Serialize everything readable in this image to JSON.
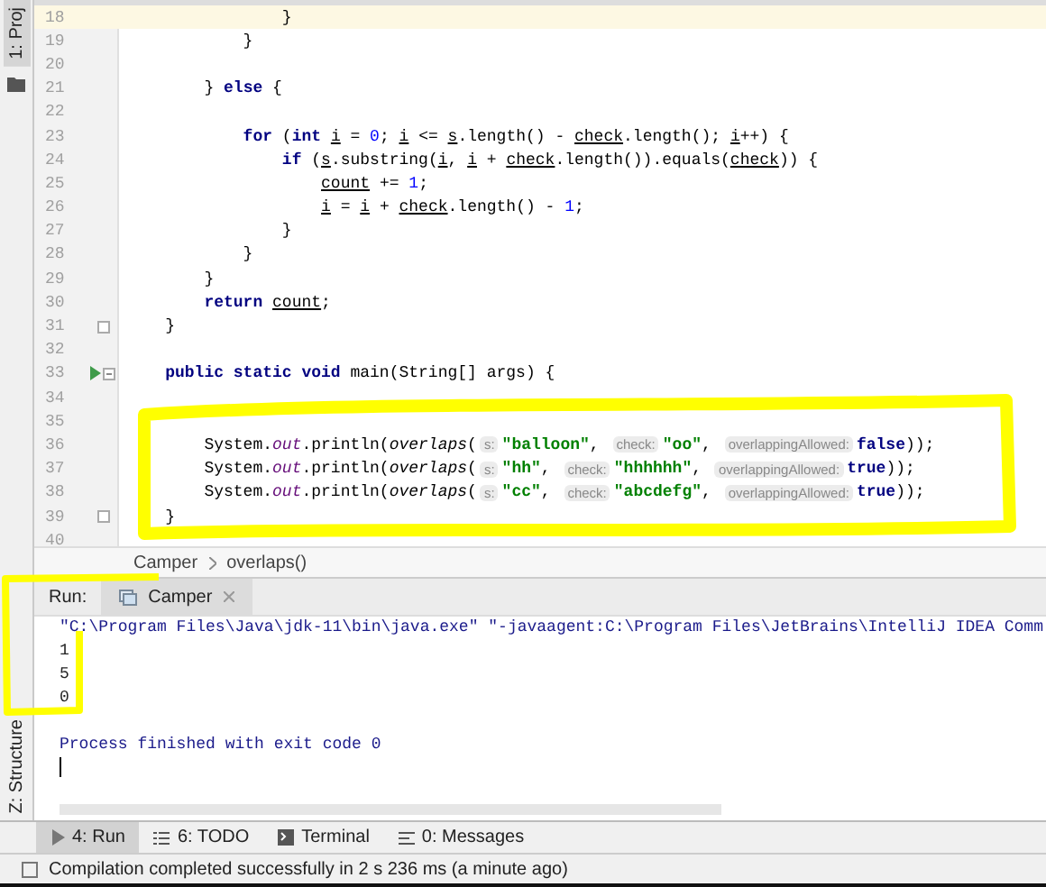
{
  "left_strip": {
    "top_tab": "1: Proj",
    "bottom_tab": "Z: Structure"
  },
  "editor": {
    "lines": [
      {
        "number": "18",
        "current": true,
        "tokens": [
          {
            "kind": "plain",
            "text": "                }"
          }
        ]
      },
      {
        "number": "19",
        "current": false,
        "tokens": [
          {
            "kind": "plain",
            "text": "            }"
          }
        ]
      },
      {
        "number": "20",
        "current": false
      },
      {
        "number": "21",
        "current": false,
        "tokens": [
          {
            "kind": "plain",
            "text": "        } "
          },
          {
            "kind": "kw",
            "text": "else"
          },
          {
            "kind": "plain",
            "text": " {"
          }
        ]
      },
      {
        "number": "22",
        "current": false
      },
      {
        "number": "23",
        "current": false,
        "tokens": [
          {
            "kind": "kw",
            "text": "            for"
          },
          {
            "kind": "plain",
            "text": " ("
          },
          {
            "kind": "kw",
            "text": "int"
          },
          {
            "kind": "var",
            "text": " i"
          },
          {
            "kind": "plain",
            "text": " = "
          },
          {
            "kind": "num",
            "text": "0"
          },
          {
            "kind": "plain",
            "text": "; "
          },
          {
            "kind": "var",
            "text": "i"
          },
          {
            "kind": "plain",
            "text": " <= "
          },
          {
            "kind": "var",
            "text": "s"
          },
          {
            "kind": "plain",
            "text": ".length() - "
          },
          {
            "kind": "var",
            "text": "check"
          },
          {
            "kind": "plain",
            "text": ".length(); "
          },
          {
            "kind": "var",
            "text": "i"
          },
          {
            "kind": "plain",
            "text": "++) {"
          }
        ]
      },
      {
        "number": "24",
        "current": false,
        "tokens": [
          {
            "kind": "kw",
            "text": "                if"
          },
          {
            "kind": "plain",
            "text": " ("
          },
          {
            "kind": "var",
            "text": "s"
          },
          {
            "kind": "plain",
            "text": ".substring("
          },
          {
            "kind": "var",
            "text": "i"
          },
          {
            "kind": "plain",
            "text": ", "
          },
          {
            "kind": "var",
            "text": "i"
          },
          {
            "kind": "plain",
            "text": " + "
          },
          {
            "kind": "var",
            "text": "check"
          },
          {
            "kind": "plain",
            "text": ".length()).equals("
          },
          {
            "kind": "var",
            "text": "check"
          },
          {
            "kind": "plain",
            "text": ")) {"
          }
        ]
      },
      {
        "number": "25",
        "current": false,
        "tokens": [
          {
            "kind": "var",
            "text": "                    count"
          },
          {
            "kind": "plain",
            "text": " += "
          },
          {
            "kind": "num",
            "text": "1"
          },
          {
            "kind": "plain",
            "text": ";"
          }
        ]
      },
      {
        "number": "26",
        "current": false,
        "tokens": [
          {
            "kind": "var",
            "text": "                    i"
          },
          {
            "kind": "plain",
            "text": " = "
          },
          {
            "kind": "var",
            "text": "i"
          },
          {
            "kind": "plain",
            "text": " + "
          },
          {
            "kind": "var",
            "text": "check"
          },
          {
            "kind": "plain",
            "text": ".length() - "
          },
          {
            "kind": "num",
            "text": "1"
          },
          {
            "kind": "plain",
            "text": ";"
          }
        ]
      },
      {
        "number": "27",
        "current": false,
        "tokens": [
          {
            "kind": "plain",
            "text": "                }"
          }
        ]
      },
      {
        "number": "28",
        "current": false,
        "tokens": [
          {
            "kind": "plain",
            "text": "            }"
          }
        ]
      },
      {
        "number": "29",
        "current": false,
        "tokens": [
          {
            "kind": "plain",
            "text": "        }"
          }
        ]
      },
      {
        "number": "30",
        "current": false,
        "tokens": [
          {
            "kind": "kw",
            "text": "        return"
          },
          {
            "kind": "var",
            "text": " count"
          },
          {
            "kind": "plain",
            "text": ";"
          }
        ]
      },
      {
        "number": "31",
        "current": false,
        "fold_marker": true,
        "tokens": [
          {
            "kind": "plain",
            "text": "    }"
          }
        ]
      },
      {
        "number": "32",
        "current": false
      },
      {
        "number": "33",
        "current": false,
        "fold_marker": true,
        "run": true,
        "tokens": [
          {
            "kind": "kw",
            "text": "    public static void"
          },
          {
            "kind": "plain",
            "text": " main(String[] args) {"
          }
        ]
      },
      {
        "number": "34",
        "current": false
      },
      {
        "number": "35",
        "current": false
      },
      {
        "number": "36",
        "current": false,
        "tokens": [
          {
            "kind": "plain",
            "text": "        System."
          },
          {
            "kind": "field",
            "text": "out"
          },
          {
            "kind": "plain",
            "text": ".println("
          },
          {
            "kind": "call",
            "text": "overlaps"
          },
          {
            "kind": "plain",
            "text": "("
          },
          {
            "kind": "hint",
            "text": "s:"
          },
          {
            "kind": "str",
            "text": "\"balloon\""
          },
          {
            "kind": "plain",
            "text": ", "
          },
          {
            "kind": "hint",
            "text": "check:"
          },
          {
            "kind": "str",
            "text": "\"oo\""
          },
          {
            "kind": "plain",
            "text": ", "
          },
          {
            "kind": "hint",
            "text": "overlappingAllowed:"
          },
          {
            "kind": "kw",
            "text": "false"
          },
          {
            "kind": "plain",
            "text": "));"
          }
        ]
      },
      {
        "number": "37",
        "current": false,
        "tokens": [
          {
            "kind": "plain",
            "text": "        System."
          },
          {
            "kind": "field",
            "text": "out"
          },
          {
            "kind": "plain",
            "text": ".println("
          },
          {
            "kind": "call",
            "text": "overlaps"
          },
          {
            "kind": "plain",
            "text": "("
          },
          {
            "kind": "hint",
            "text": "s:"
          },
          {
            "kind": "str",
            "text": "\"hh\""
          },
          {
            "kind": "plain",
            "text": ", "
          },
          {
            "kind": "hint",
            "text": "check:"
          },
          {
            "kind": "str",
            "text": "\"hhhhhh\""
          },
          {
            "kind": "plain",
            "text": ", "
          },
          {
            "kind": "hint",
            "text": "overlappingAllowed:"
          },
          {
            "kind": "kw",
            "text": "true"
          },
          {
            "kind": "plain",
            "text": "));"
          }
        ]
      },
      {
        "number": "38",
        "current": false,
        "tokens": [
          {
            "kind": "plain",
            "text": "        System."
          },
          {
            "kind": "field",
            "text": "out"
          },
          {
            "kind": "plain",
            "text": ".println("
          },
          {
            "kind": "call",
            "text": "overlaps"
          },
          {
            "kind": "plain",
            "text": "("
          },
          {
            "kind": "hint",
            "text": "s:"
          },
          {
            "kind": "str",
            "text": "\"cc\""
          },
          {
            "kind": "plain",
            "text": ", "
          },
          {
            "kind": "hint",
            "text": "check:"
          },
          {
            "kind": "str",
            "text": "\"abcdefg\""
          },
          {
            "kind": "plain",
            "text": ", "
          },
          {
            "kind": "hint",
            "text": "overlappingAllowed:"
          },
          {
            "kind": "kw",
            "text": "true"
          },
          {
            "kind": "plain",
            "text": "));"
          }
        ]
      },
      {
        "number": "39",
        "current": false,
        "fold_marker": true,
        "tokens": [
          {
            "kind": "plain",
            "text": "    }"
          }
        ]
      },
      {
        "number": "40",
        "current": false
      }
    ]
  },
  "breadcrumb": [
    "Camper",
    "overlaps()"
  ],
  "run_panel": {
    "label": "Run:",
    "tab": "Camper",
    "console": [
      {
        "kind": "command",
        "text": "\"C:\\Program Files\\Java\\jdk-11\\bin\\java.exe\" \"-javaagent:C:\\Program Files\\JetBrains\\IntelliJ IDEA Comm"
      },
      {
        "kind": "output",
        "text": "1"
      },
      {
        "kind": "output",
        "text": "5"
      },
      {
        "kind": "output",
        "text": "0"
      },
      {
        "kind": "exit",
        "text": "Process finished with exit code 0"
      }
    ]
  },
  "tool_tabs": [
    {
      "label": "4: Run",
      "selected": true
    },
    {
      "label": "6: TODO",
      "selected": false
    },
    {
      "label": "Terminal",
      "selected": false
    },
    {
      "label": "0: Messages",
      "selected": false
    }
  ],
  "status_bar": "Compilation completed successfully in 2 s 236 ms (a minute ago)"
}
